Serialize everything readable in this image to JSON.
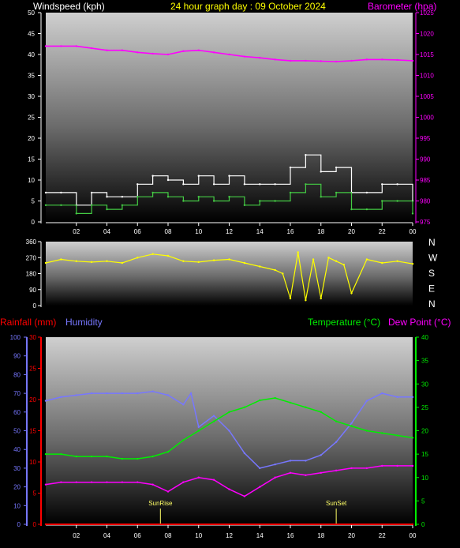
{
  "chart_data": [
    {
      "type": "line",
      "title": "24 hour graph day : 09 October 2024",
      "left_label": "Windspeed (kph)",
      "right_label": "Barometer (hpa)",
      "x_ticks": [
        "02",
        "04",
        "06",
        "08",
        "10",
        "12",
        "14",
        "16",
        "18",
        "20",
        "22",
        "00"
      ],
      "y_left_ticks": [
        "0",
        "5",
        "10",
        "15",
        "20",
        "25",
        "30",
        "35",
        "40",
        "45",
        "50"
      ],
      "y_right_ticks": [
        "975",
        "980",
        "985",
        "990",
        "995",
        "1000",
        "1005",
        "1010",
        "1015",
        "1020",
        "1025"
      ],
      "ylim_left": [
        0,
        50
      ],
      "ylim_right": [
        975,
        1025
      ],
      "colors": {
        "gust": "#ffffff",
        "windspeed": "#44cc44",
        "barometer": "#ff00ff"
      },
      "series": [
        {
          "color_key": "gust",
          "x": [
            0,
            1,
            2,
            3,
            4,
            5,
            6,
            7,
            8,
            9,
            10,
            11,
            12,
            13,
            14,
            15,
            16,
            17,
            18,
            19,
            20,
            21,
            22,
            23,
            24
          ],
          "values": [
            7,
            7,
            4,
            7,
            6,
            6,
            9,
            11,
            10,
            9,
            11,
            9,
            11,
            9,
            9,
            9,
            13,
            16,
            12,
            13,
            7,
            7,
            9,
            9,
            5
          ]
        },
        {
          "color_key": "windspeed",
          "x": [
            0,
            1,
            2,
            3,
            4,
            5,
            6,
            7,
            8,
            9,
            10,
            11,
            12,
            13,
            14,
            15,
            16,
            17,
            18,
            19,
            20,
            21,
            22,
            23,
            24
          ],
          "values": [
            4,
            4,
            2,
            4,
            3,
            4,
            6,
            7,
            6,
            5,
            6,
            5,
            6,
            4,
            5,
            5,
            7,
            9,
            6,
            7,
            3,
            3,
            5,
            5,
            2
          ]
        },
        {
          "color_key": "barometer",
          "x": [
            0,
            1,
            2,
            3,
            4,
            5,
            6,
            7,
            8,
            9,
            10,
            11,
            12,
            13,
            14,
            15,
            16,
            17,
            18,
            19,
            20,
            21,
            22,
            23,
            24
          ],
          "values": [
            1017,
            1017,
            1017,
            1016.5,
            1016,
            1016,
            1015.5,
            1015.2,
            1015,
            1015.8,
            1016,
            1015.5,
            1015,
            1014.5,
            1014.2,
            1013.8,
            1013.5,
            1013.5,
            1013.4,
            1013.3,
            1013.5,
            1013.8,
            1013.8,
            1013.7,
            1013.5
          ]
        }
      ]
    },
    {
      "type": "scatter",
      "y_ticks": [
        "0",
        "90",
        "180",
        "270",
        "360"
      ],
      "compass": [
        "N",
        "W",
        "S",
        "E",
        "N"
      ],
      "ylim": [
        0,
        360
      ],
      "colors": {
        "direction": "#ffff00"
      },
      "series": [
        {
          "color_key": "direction",
          "x": [
            0,
            1,
            2,
            3,
            4,
            5,
            6,
            7,
            8,
            9,
            10,
            11,
            12,
            13,
            14,
            15,
            15.5,
            16,
            16.5,
            17,
            17.5,
            18,
            18.5,
            19,
            19.5,
            20,
            21,
            22,
            23,
            24
          ],
          "values": [
            240,
            260,
            250,
            245,
            250,
            240,
            270,
            290,
            280,
            250,
            245,
            255,
            260,
            240,
            220,
            200,
            180,
            40,
            300,
            30,
            260,
            40,
            270,
            250,
            230,
            70,
            260,
            240,
            250,
            235
          ]
        }
      ]
    },
    {
      "type": "line",
      "left_labels": [
        "Rainfall (mm)",
        "Humidity"
      ],
      "right_labels": [
        "Temperature (°C)",
        "Dew Point (°C)"
      ],
      "x_ticks": [
        "02",
        "04",
        "06",
        "08",
        "10",
        "12",
        "14",
        "16",
        "18",
        "20",
        "22",
        "00"
      ],
      "humidity_ticks": [
        "0",
        "10",
        "20",
        "30",
        "40",
        "50",
        "60",
        "70",
        "80",
        "90",
        "100"
      ],
      "rain_ticks": [
        "0",
        "5",
        "10",
        "15",
        "20",
        "25",
        "30"
      ],
      "temp_ticks": [
        "0",
        "5",
        "10",
        "15",
        "20",
        "25",
        "30",
        "35",
        "40"
      ],
      "ylim_humidity": [
        0,
        100
      ],
      "ylim_rain": [
        0,
        30
      ],
      "ylim_temp": [
        0,
        40
      ],
      "annotations": [
        "SunRise",
        "SunSet"
      ],
      "colors": {
        "rainfall": "#ff0000",
        "humidity": "#7777ff",
        "temperature": "#00ee00",
        "dewpoint": "#ff00ff",
        "sun": "#ffff66"
      },
      "series": [
        {
          "color_key": "humidity",
          "x": [
            0,
            1,
            2,
            3,
            4,
            5,
            6,
            7,
            8,
            9,
            9.5,
            10,
            11,
            12,
            13,
            14,
            15,
            16,
            17,
            18,
            19,
            20,
            21,
            22,
            23,
            24
          ],
          "values": [
            66,
            68,
            69,
            70,
            70,
            70,
            70,
            71,
            69,
            64,
            70,
            52,
            58,
            50,
            38,
            30,
            32,
            34,
            34,
            37,
            44,
            54,
            66,
            70,
            68,
            68
          ]
        },
        {
          "color_key": "temperature",
          "x": [
            0,
            1,
            2,
            3,
            4,
            5,
            6,
            7,
            8,
            9,
            10,
            11,
            12,
            13,
            14,
            15,
            16,
            17,
            18,
            19,
            20,
            21,
            22,
            23,
            24
          ],
          "values": [
            15,
            15,
            14.5,
            14.5,
            14.5,
            14,
            14,
            14.5,
            15.5,
            18,
            20,
            22,
            24,
            25,
            26.5,
            27,
            26,
            25,
            24,
            22,
            21,
            20,
            19.5,
            19,
            18.5
          ]
        },
        {
          "color_key": "dewpoint",
          "x": [
            0,
            1,
            2,
            3,
            4,
            5,
            6,
            7,
            8,
            9,
            10,
            11,
            12,
            13,
            14,
            15,
            16,
            17,
            18,
            19,
            20,
            21,
            22,
            23,
            24
          ],
          "values": [
            8.5,
            9,
            9,
            9,
            9,
            9,
            9,
            8.5,
            7,
            9,
            10,
            9.5,
            7.5,
            6,
            8,
            10,
            11,
            10.5,
            11,
            11.5,
            12,
            12,
            12.5,
            12.5,
            12.5
          ]
        },
        {
          "color_key": "rainfall",
          "x": [
            0,
            24
          ],
          "values": [
            0,
            0
          ]
        }
      ],
      "sun_events": [
        {
          "label": "SunRise",
          "x": 7.5
        },
        {
          "label": "SunSet",
          "x": 19.0
        }
      ]
    }
  ]
}
